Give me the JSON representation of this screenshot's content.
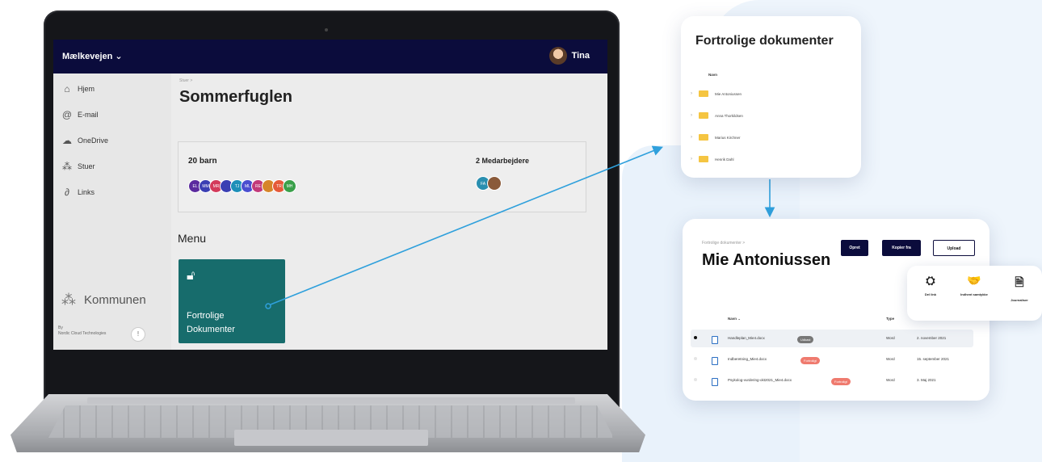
{
  "topbar": {
    "title": "Mælkevejen ⌄",
    "user": "Tina"
  },
  "sidebar": {
    "items": [
      {
        "icon": "home-icon",
        "glyph": "⌂",
        "label": "Hjem"
      },
      {
        "icon": "email-icon",
        "glyph": "@",
        "label": "E-mail"
      },
      {
        "icon": "cloud-icon",
        "glyph": "☁",
        "label": "OneDrive"
      },
      {
        "icon": "sites-icon",
        "glyph": "⁂",
        "label": "Stuer"
      },
      {
        "icon": "link-icon",
        "glyph": "∂",
        "label": "Links"
      }
    ],
    "brand": "Kommunen",
    "footer_by": "By",
    "footer_company": "Nordic Cloud Technologies",
    "help": "!"
  },
  "main": {
    "breadcrumb": "Stuer >",
    "title": "Sommerfuglen",
    "children_count": "20 barn",
    "staff_count": "2 Medarbejdere",
    "children": [
      {
        "initials": "EL",
        "color": "#5b2a9e"
      },
      {
        "initials": "MM",
        "color": "#3a3fb3"
      },
      {
        "initials": "MR",
        "color": "#d33a5a"
      },
      {
        "initials": "",
        "color": "#3a3fb3"
      },
      {
        "initials": "TJ",
        "color": "#1d8fb8"
      },
      {
        "initials": "ML",
        "color": "#4a4ed0"
      },
      {
        "initials": "RE",
        "color": "#c23a7a"
      },
      {
        "initials": "",
        "color": "#d6852a"
      },
      {
        "initials": "TR",
        "color": "#e55a3a"
      },
      {
        "initials": "MH",
        "color": "#3aa04a"
      }
    ],
    "staff": [
      {
        "initials": "FA",
        "color": "#2a8fb0"
      },
      {
        "initials": "",
        "color": "#8a5a3a"
      }
    ],
    "menu_label": "Menu",
    "tile_line1": "Fortrolige",
    "tile_line2": "Dokumenter"
  },
  "folders_popup": {
    "title": "Fortrolige dokumenter",
    "column": "Navn",
    "folders": [
      "Mie Antoniussen",
      "Anna Thorkildsen",
      "Marius Kirchner",
      "Henrik Dahl"
    ]
  },
  "docs_popup": {
    "breadcrumb": "Fortrolige dokumenter  >",
    "title": "Mie Antoniussen",
    "buttons": [
      "Opret",
      "Kopier fra",
      "Upload"
    ],
    "headers": {
      "name": "Navn ⌄",
      "type": "Type",
      "modified": "Seneste ændring"
    },
    "rows": [
      {
        "name": "Handleplan_Mie4.docx",
        "tag": "Udkast",
        "tag_color": "#777777",
        "type": "Word",
        "modified": "2. november 2021"
      },
      {
        "name": "Indberetning_Mie4.docx",
        "tag": "Fortroligt",
        "tag_color": "#ef7a6e",
        "type": "Word",
        "modified": "15. september 2021"
      },
      {
        "name": "Psykolog-vurdering-okt2021_Mie4.docx",
        "tag": "Fortroligt",
        "tag_color": "#ef7a6e",
        "type": "Word",
        "modified": "3. Maj 2021"
      }
    ]
  },
  "actions_popup": {
    "items": [
      {
        "icon": "share-link-icon",
        "glyph": "⛭",
        "label": "Del link"
      },
      {
        "icon": "handshake-icon",
        "glyph": "🤝",
        "label": "Indhent samtykke"
      },
      {
        "icon": "journal-icon",
        "glyph": "🗎",
        "label": "Journaliser"
      }
    ]
  },
  "colors": {
    "topbar": "#0b0c3c",
    "tile": "#176c6c",
    "arrow": "#2fa0dc",
    "folder": "#f5c542"
  }
}
